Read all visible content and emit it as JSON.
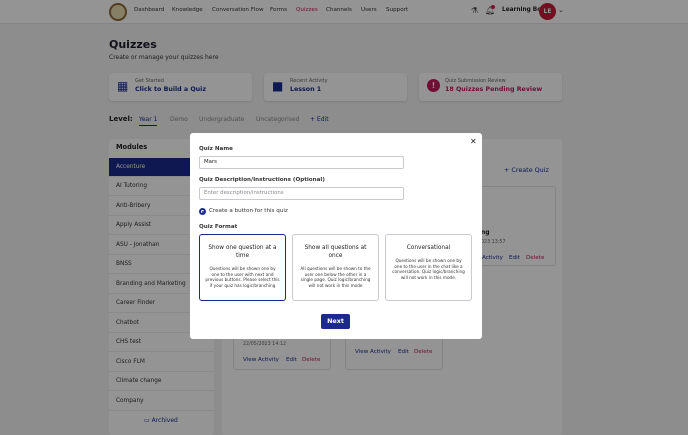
{
  "nav": {
    "items": [
      "Dashboard",
      "Knowledge",
      "Conversation Flow",
      "Forms",
      "Quizzes",
      "Channels",
      "Users",
      "Support"
    ],
    "active": "Quizzes",
    "bot_name": "Learning Bot",
    "avatar_initials": "LE",
    "icons": [
      "flask-icon",
      "bell-icon",
      "chevron-down-icon"
    ]
  },
  "page": {
    "title": "Quizzes",
    "subtitle": "Create or manage your quizzes here"
  },
  "cards": [
    {
      "label": "Get Started",
      "value": "Click to Build a Quiz",
      "icon": "quiz-build-icon"
    },
    {
      "label": "Recent Activity",
      "value": "Lesson 1",
      "icon": "folder-icon"
    },
    {
      "label": "Quiz Submission Review",
      "value": "18 Quizzes Pending Review",
      "icon": "alert-icon",
      "icon_text": "!"
    }
  ],
  "levels": {
    "label": "Level:",
    "tabs": [
      "Year 1",
      "Demo",
      "Undergraduate",
      "Uncategorised"
    ],
    "active": "Year 1",
    "add_label": "+ Edit"
  },
  "modules": {
    "title": "Modules",
    "items": [
      "Accenture",
      "AI Tutoring",
      "Anti-Bribery",
      "Apply Assist",
      "ASU - Jonathan",
      "BNSS",
      "Branding and Marketing",
      "Career Finder",
      "Chatbot",
      "CHS test",
      "Cisco FLM",
      "Climate change",
      "Company"
    ],
    "active": "Accenture",
    "archived_label": "Archived"
  },
  "quizzes_panel": {
    "create_label": "+ Create Quiz",
    "visible_fragments": [
      "ng",
      "023 13:57"
    ],
    "actions": [
      "Activity",
      "Edit",
      "Delete"
    ],
    "lower_cards": [
      {
        "date": "22/05/2023 14:12",
        "actions": [
          "View Activity",
          "Edit",
          "Delete"
        ]
      },
      {
        "actions": [
          "View Activity",
          "Edit",
          "Delete"
        ]
      }
    ]
  },
  "modal": {
    "close_glyph": "✕",
    "quiz_name_label": "Quiz Name",
    "quiz_name_value": "Mars",
    "description_label": "Quiz Description/Instructions (Optional)",
    "description_placeholder": "Enter description/instructions",
    "button_option_label": "Create a button for this quiz",
    "format_label": "Quiz Format",
    "formats": [
      {
        "title": "Show one question at a time",
        "desc": "Questions will be shown one by one to the user with next and previous buttons. Please select this if your quiz has logic/branching",
        "selected": true
      },
      {
        "title": "Show all questions at once",
        "desc": "All questions will be shown to the user one below the other in a single page. Quiz logic/branching will not work in this mode",
        "selected": false
      },
      {
        "title": "Conversational",
        "desc": "Questions will be shown one by one to the user in the chat like a conversation. Quiz logic/branching will not work in this mode.",
        "selected": false
      }
    ],
    "next_label": "Next"
  },
  "colors": {
    "primary": "#1b2a8c",
    "accent": "#c2195b",
    "avatar": "#c41d3a"
  }
}
